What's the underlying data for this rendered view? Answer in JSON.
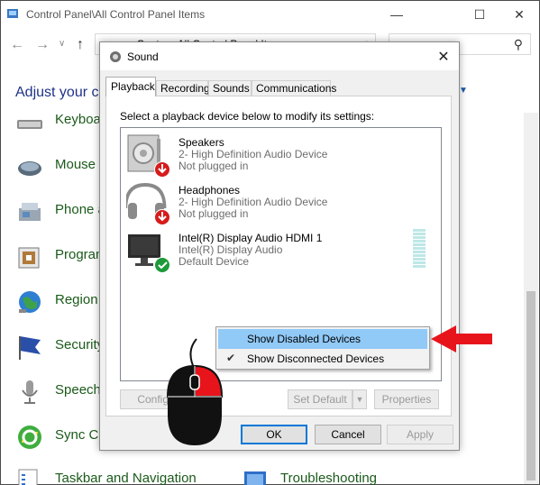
{
  "control_panel": {
    "title": "Control Panel\\All Control Panel Items",
    "address_crumb": "› Cont... › All Control Panel Ite...",
    "heading": "Adjust your co",
    "items": [
      {
        "label": "Keyboa",
        "icon": "keyboard-icon"
      },
      {
        "label": "Mouse",
        "icon": "mouse-icon"
      },
      {
        "label": "Phone a",
        "icon": "phone-modem-icon"
      },
      {
        "label": "Program",
        "icon": "programs-icon"
      },
      {
        "label": "Region",
        "icon": "globe-icon"
      },
      {
        "label": "Security",
        "icon": "flag-icon"
      },
      {
        "label": "Speech",
        "icon": "microphone-icon"
      },
      {
        "label": "Sync Ce",
        "icon": "sync-icon"
      },
      {
        "label": "Taskbar and Navigation",
        "icon": "taskbar-icon"
      },
      {
        "label": "Troubleshooting",
        "icon": "troubleshooting-icon"
      }
    ]
  },
  "dialog": {
    "title": "Sound",
    "close_glyph": "✕",
    "tabs": [
      "Playback",
      "Recording",
      "Sounds",
      "Communications"
    ],
    "active_tab": "Playback",
    "instruction": "Select a playback device below to modify its settings:",
    "devices": [
      {
        "name": "Speakers",
        "line2": "2- High Definition Audio Device",
        "status": "Not plugged in",
        "icon": "speaker-icon",
        "badge": "red-down-arrow"
      },
      {
        "name": "Headphones",
        "line2": "2- High Definition Audio Device",
        "status": "Not plugged in",
        "icon": "headphones-icon",
        "badge": "red-down-arrow"
      },
      {
        "name": "Intel(R) Display Audio HDMI 1",
        "line2": "Intel(R) Display Audio",
        "status": "Default Device",
        "icon": "monitor-icon",
        "badge": "green-check"
      }
    ],
    "buttons": {
      "configure": "Configu",
      "set_default": "Set Default",
      "properties": "Properties",
      "ok": "OK",
      "cancel": "Cancel",
      "apply": "Apply"
    }
  },
  "context_menu": {
    "items": [
      {
        "label": "Show Disabled Devices",
        "checked": false,
        "highlighted": true
      },
      {
        "label": "Show Disconnected Devices",
        "checked": true,
        "highlighted": false
      }
    ]
  },
  "colors": {
    "accent_blue": "#0078d7",
    "menu_highlight": "#91c9f7",
    "annotation_red": "#e8141c",
    "cp_link_green": "#1a5a1a",
    "cp_heading_blue": "#1e3287"
  }
}
